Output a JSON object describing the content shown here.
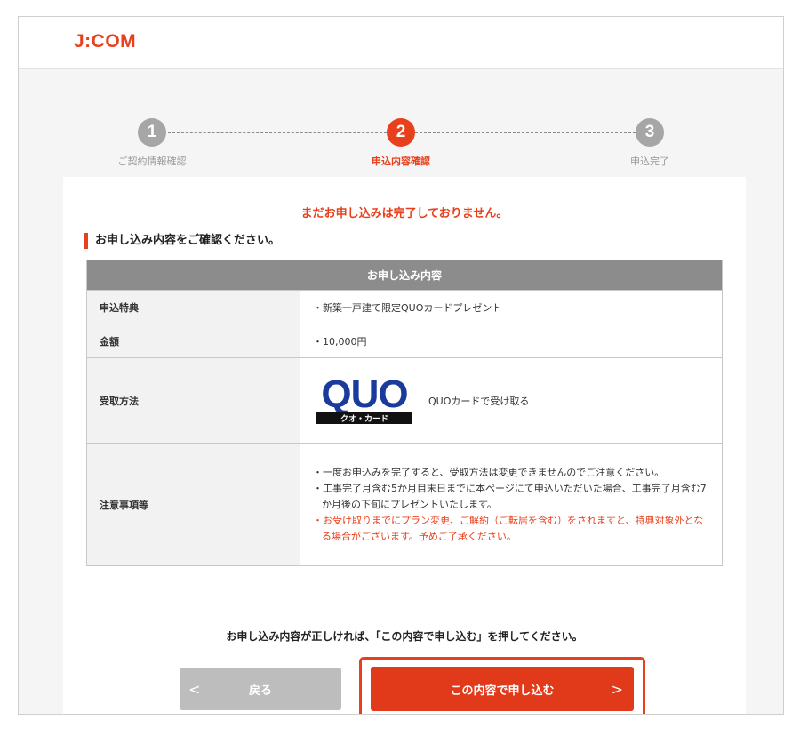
{
  "header": {
    "logo": "J:COM"
  },
  "stepper": {
    "steps": [
      {
        "number": "1",
        "label": "ご契約情報確認",
        "state": "done"
      },
      {
        "number": "2",
        "label": "申込内容確認",
        "state": "active"
      },
      {
        "number": "3",
        "label": "申込完了",
        "state": "pending"
      }
    ]
  },
  "main": {
    "warning": "まだお申し込みは完了しておりません。",
    "section_title": "お申し込み内容をご確認ください。",
    "table": {
      "caption": "お申し込み内容",
      "rows": [
        {
          "label": "申込特典",
          "value": "・新築一戸建て限定QUOカードプレゼント"
        },
        {
          "label": "金額",
          "value": "・10,000円"
        },
        {
          "label": "受取方法",
          "value": "QUOカードで受け取る",
          "logo_text": "QUO",
          "logo_sub": "クオ・カード"
        },
        {
          "label": "注意事項等",
          "notes": [
            "・一度お申込みを完了すると、受取方法は変更できませんのでご注意ください。",
            "・工事完了月含む5か月目末日までに本ページにて申込いただいた場合、工事完了月含む7か月後の下旬にプレゼントいたします。",
            "・お受け取りまでにプラン変更、ご解約（ご転居を含む）をされますと、特典対象外となる場合がございます。予めご了承ください。"
          ]
        }
      ]
    },
    "confirm_text": "お申し込み内容が正しければ、「この内容で申し込む」を押してください。",
    "back_button": "戻る",
    "submit_button": "この内容で申し込む"
  },
  "colors": {
    "accent": "#e8401c",
    "inactive": "#a6a6a6",
    "table_header": "#8c8c8c"
  },
  "icons": {
    "back": "chevron-left-icon",
    "submit": "chevron-right-icon"
  }
}
